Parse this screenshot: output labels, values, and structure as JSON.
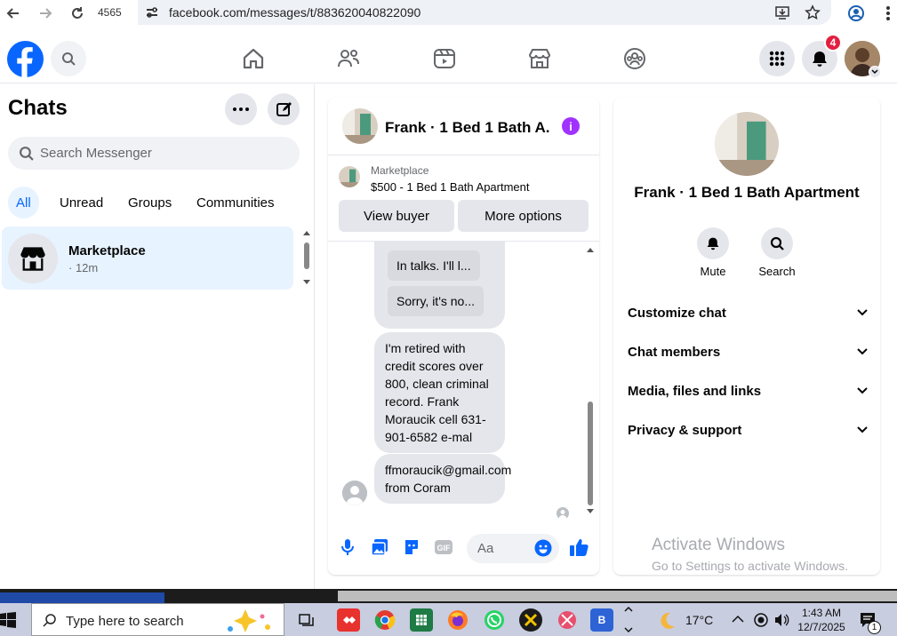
{
  "browser": {
    "tab_number": "4565",
    "url": "facebook.com/messages/t/883620040822090"
  },
  "header": {
    "notifications_count": "4"
  },
  "left": {
    "title": "Chats",
    "search_placeholder": "Search Messenger",
    "tabs": [
      "All",
      "Unread",
      "Groups",
      "Communities"
    ],
    "chat": {
      "name": "Marketplace",
      "time": "· 12m"
    }
  },
  "conversation": {
    "title": "Frank · 1 Bed 1 Bath A...",
    "marketplace_label": "Marketplace",
    "listing": "$500 - 1 Bed 1 Bath Apartment",
    "view_buyer": "View buyer",
    "more_options": "More options",
    "quick_replies": [
      "In talks. I'll l...",
      "Sorry, it's no..."
    ],
    "messages": [
      "I'm retired with credit scores over 800, clean criminal record. Frank Moraucik cell 631-901-6582 e-mal",
      "ffmoraucik@gmail.com from Coram"
    ],
    "composer_placeholder": "Aa"
  },
  "details": {
    "name": "Frank · 1 Bed 1 Bath Apartment",
    "actions": [
      "Mute",
      "Search"
    ],
    "sections": [
      "Customize chat",
      "Chat members",
      "Media, files and links",
      "Privacy & support"
    ]
  },
  "watermark": {
    "line1": "Activate Windows",
    "line2": "Go to Settings to activate Windows."
  },
  "taskbar": {
    "search_placeholder": "Type here to search",
    "weather": "17°C",
    "time": "1:43 AM",
    "date": "12/7/2025",
    "notif_count": "1"
  },
  "colors": {
    "fb_blue": "#0866ff",
    "badge_red": "#e41e3f",
    "info_purple": "#a033ff"
  }
}
